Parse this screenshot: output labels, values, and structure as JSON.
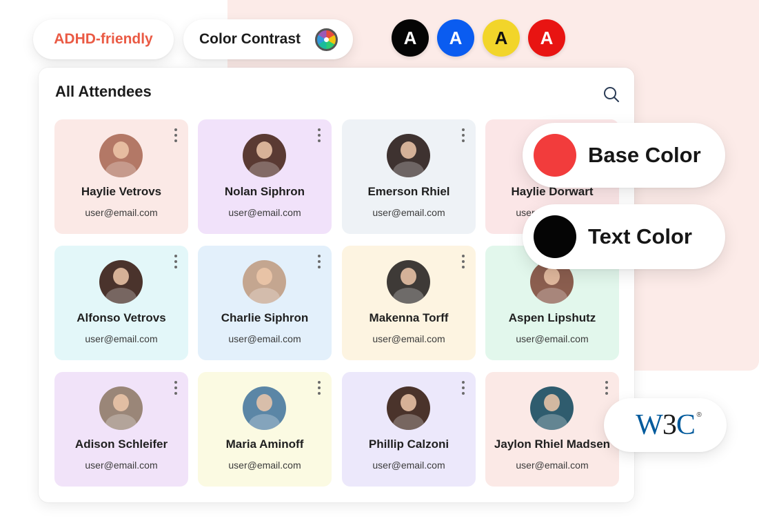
{
  "toolbar": {
    "adhd_label": "ADHD-friendly",
    "contrast_label": "Color Contrast",
    "swatches": [
      {
        "letter": "A",
        "bg": "#050505",
        "fg": "#ffffff"
      },
      {
        "letter": "A",
        "bg": "#0a5cf0",
        "fg": "#ffffff"
      },
      {
        "letter": "A",
        "bg": "#f2d52a",
        "fg": "#111111"
      },
      {
        "letter": "A",
        "bg": "#e81412",
        "fg": "#ffffff"
      }
    ]
  },
  "panel": {
    "title": "All Attendees",
    "attendees": [
      {
        "name": "Haylie Vetrovs",
        "email": "user@email.com",
        "bg": "#fbe9e6",
        "avatar": "#b37866"
      },
      {
        "name": "Nolan Siphron",
        "email": "user@email.com",
        "bg": "#f1e2fa",
        "avatar": "#5a3a33"
      },
      {
        "name": "Emerson Rhiel",
        "email": "user@email.com",
        "bg": "#eef2f6",
        "avatar": "#3e3230"
      },
      {
        "name": "Haylie Dorwart",
        "email": "user@email.com",
        "bg": "#fbe6e7",
        "avatar": "#a87a6a"
      },
      {
        "name": "Alfonso Vetrovs",
        "email": "user@email.com",
        "bg": "#e3f7f9",
        "avatar": "#4a332c"
      },
      {
        "name": "Charlie Siphron",
        "email": "user@email.com",
        "bg": "#e3f0fb",
        "avatar": "#c4a690"
      },
      {
        "name": "Makenna Torff",
        "email": "user@email.com",
        "bg": "#fdf4e1",
        "avatar": "#3e3a37"
      },
      {
        "name": "Aspen Lipshutz",
        "email": "user@email.com",
        "bg": "#e2f7ec",
        "avatar": "#8b5e4f"
      },
      {
        "name": "Adison Schleifer",
        "email": "user@email.com",
        "bg": "#f1e3f9",
        "avatar": "#9a8678"
      },
      {
        "name": "Maria Aminoff",
        "email": "user@email.com",
        "bg": "#fbfae2",
        "avatar": "#5b86a6"
      },
      {
        "name": "Phillip Calzoni",
        "email": "user@email.com",
        "bg": "#ece8fb",
        "avatar": "#4a332b"
      },
      {
        "name": "Jaylon Rhiel Madsen",
        "email": "user@email.com",
        "bg": "#fbe9e6",
        "avatar": "#2f5c6e"
      }
    ]
  },
  "color_controls": {
    "base_label": "Base Color",
    "base_color": "#f23c3c",
    "text_label": "Text Color",
    "text_color": "#050505"
  },
  "badge": {
    "w3c_w": "W",
    "w3c_3": "3",
    "w3c_c": "C",
    "w3c_reg": "®"
  },
  "icons": {
    "search": "search-icon",
    "menu": "kebab-menu-icon",
    "wheel": "color-wheel-icon"
  }
}
